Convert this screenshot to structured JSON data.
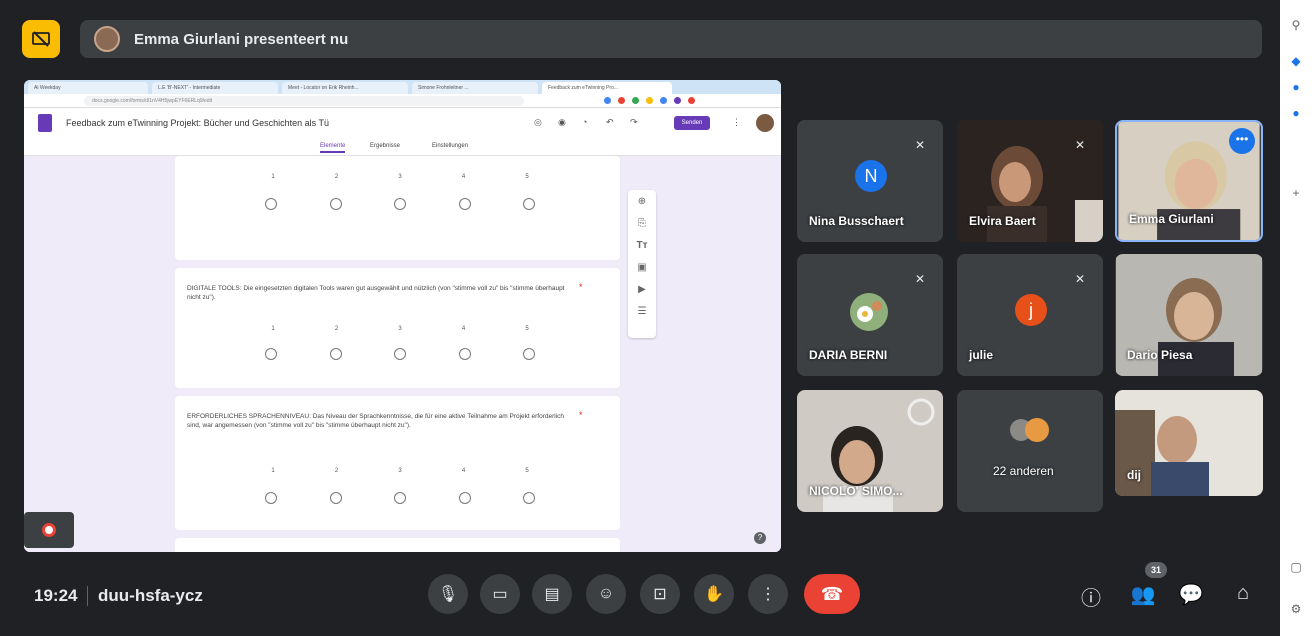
{
  "presenter_banner": {
    "text": "Emma Giurlani presenteert nu",
    "icon": "present-off-icon"
  },
  "shared_screen": {
    "browser_tabs": [
      "Ai Weekday",
      "L.E 'B'-NEXT' - Intermediate",
      "Meet - Locator on Erik Rheinh...",
      "Simone Frohnleitner ...",
      "Feedback zum eTwinning Pro..."
    ],
    "url": "docs.google.com/forms/d/1nV4H5jwpEYF6ERLq9/edit",
    "form_title": "Feedback zum eTwinning Projekt: Bücher und Geschichten als Tü",
    "send_label": "Senden",
    "subtabs": [
      "Elemente",
      "Ergebnisse",
      "Einstellungen"
    ],
    "results_badge": "",
    "scale_numbers": [
      "1",
      "2",
      "3",
      "4",
      "5"
    ],
    "questions": [
      {
        "text": "",
        "required": ""
      },
      {
        "text": "DIGITALE TOOLS: Die eingesetzten digitalen Tools waren gut ausgewählt und nützlich (von \"stimme voll zu\" bis \"stimme überhaupt nicht zu\").",
        "required": "*"
      },
      {
        "text": "ERFORDERLICHES SPRACHENNIVEAU: Das Niveau der Sprachkenntnisse, die für eine aktive Teilnahme am Projekt erforderlich sind, war angemessen (von \"stimme voll zu\" bis \"stimme überhaupt nicht zu\").",
        "required": "*"
      }
    ]
  },
  "participants": [
    {
      "name": "Nina Busschaert",
      "initial": "N",
      "color": "#1a73e8",
      "muted": true,
      "type": "avatar"
    },
    {
      "name": "Elvira Baert",
      "muted": true,
      "type": "video"
    },
    {
      "name": "Emma Giurlani",
      "muted": false,
      "type": "video",
      "pinned": true
    },
    {
      "name": "DARIA BERNI",
      "muted": true,
      "type": "avatar-image"
    },
    {
      "name": "julie",
      "initial": "j",
      "color": "#e8501a",
      "muted": true,
      "type": "avatar"
    },
    {
      "name": "Dario Piesa",
      "muted": false,
      "type": "video"
    },
    {
      "name": "NICOLO' SIMO...",
      "muted": false,
      "type": "video"
    },
    {
      "name": "22 anderen",
      "muted": false,
      "type": "others"
    },
    {
      "name": "dij",
      "muted": false,
      "type": "video"
    }
  ],
  "bottombar": {
    "time": "19:24",
    "meeting_code": "duu-hsfa-ycz",
    "people_count": "31"
  }
}
